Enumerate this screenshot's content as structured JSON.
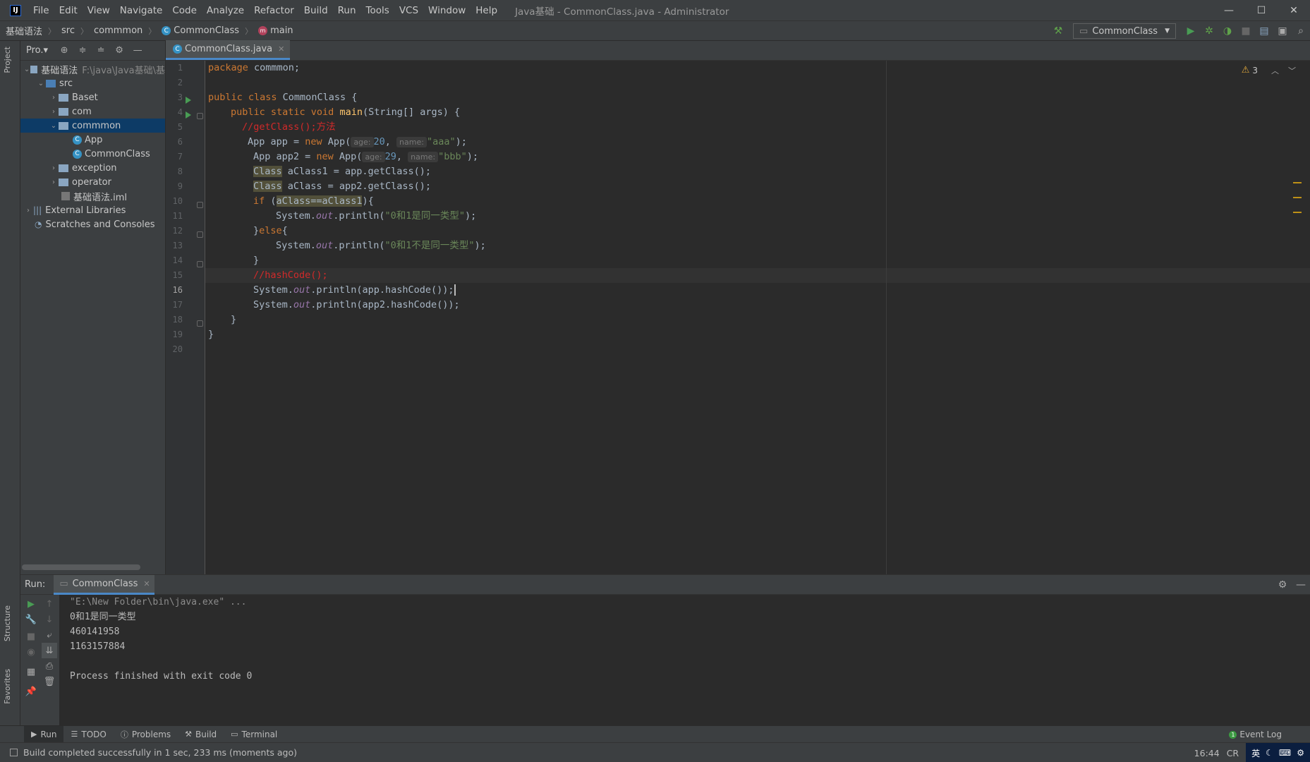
{
  "titlebar": {
    "logo": "IJ",
    "menu": [
      "File",
      "Edit",
      "View",
      "Navigate",
      "Code",
      "Analyze",
      "Refactor",
      "Build",
      "Run",
      "Tools",
      "VCS",
      "Window",
      "Help"
    ],
    "title": "Java基础 - CommonClass.java - Administrator",
    "minimize": "—",
    "maximize": "☐",
    "close": "✕"
  },
  "breadcrumb": {
    "items": [
      "基础语法",
      "src",
      "commmon",
      "CommonClass",
      "main"
    ],
    "class_icon": "C",
    "method_icon": "m"
  },
  "toolbar": {
    "run_config": "CommonClass"
  },
  "left_strip": {
    "project_label": "Project",
    "structure_label": "Structure",
    "favorites_label": "Favorites"
  },
  "project": {
    "header": "Pro.▾",
    "tree": {
      "root": {
        "label": "基础语法",
        "path": "F:\\java\\Java基础\\基"
      },
      "src": "src",
      "baset": "Baset",
      "com": "com",
      "common": "commmon",
      "app": "App",
      "commonclass": "CommonClass",
      "exception": "exception",
      "operator": "operator",
      "iml": "基础语法.iml",
      "external": "External Libraries",
      "scratches": "Scratches and Consoles"
    }
  },
  "editor": {
    "tab": "CommonClass.java",
    "warnings": "3",
    "line_numbers": [
      "1",
      "2",
      "3",
      "4",
      "5",
      "6",
      "7",
      "8",
      "9",
      "10",
      "11",
      "12",
      "13",
      "14",
      "15",
      "16",
      "17",
      "18",
      "19",
      "20"
    ],
    "code": {
      "l1_kw": "package",
      "l1_rest": " commmon;",
      "l3_kw1": "public class",
      "l3_rest": " CommonClass {",
      "l4_kw": "public static void",
      "l4_fn": "main",
      "l4_rest": "(String[] args) {",
      "l5_cmt": "//getClass();方法",
      "l6_a": "App app = ",
      "l6_kw": "new",
      "l6_b": " App(",
      "l6_h1": "age:",
      "l6_n": "20",
      "l6_c": ", ",
      "l6_h2": "name:",
      "l6_s": "\"aaa\"",
      "l6_d": ");",
      "l7_a": "App app2 = ",
      "l7_kw": "new",
      "l7_b": " App(",
      "l7_h1": "age:",
      "l7_n": "29",
      "l7_c": ", ",
      "l7_h2": "name:",
      "l7_s": "\"bbb\"",
      "l7_d": ");",
      "l8_cls": "Class",
      "l8_rest": " aClass1 = app.getClass();",
      "l9_cls": "Class",
      "l9_rest": " aClass = app2.getClass();",
      "l10_kw": "if",
      "l10_a": " (",
      "l10_hl": "aClass==aClass1",
      "l10_b": "){",
      "l11_a": "System.",
      "l11_st": "out",
      "l11_b": ".println(",
      "l11_s": "\"0和1是同一类型\"",
      "l11_c": ");",
      "l12_a": "}",
      "l12_kw": "else",
      "l12_b": "{",
      "l13_a": "System.",
      "l13_st": "out",
      "l13_b": ".println(",
      "l13_s": "\"0和1不是同一类型\"",
      "l13_c": ");",
      "l14": "}",
      "l15_cmt": "//hashCode();",
      "l16_a": "System.",
      "l16_st": "out",
      "l16_b": ".println(app.hashCode());",
      "l17_a": "System.",
      "l17_st": "out",
      "l17_b": ".println(app2.hashCode());",
      "l18": "}",
      "l19": "}"
    }
  },
  "run": {
    "label": "Run:",
    "tab": "CommonClass",
    "console": [
      "\"E:\\New Folder\\bin\\java.exe\" ...",
      "0和1是同一类型",
      "460141958",
      "1163157884",
      "",
      "Process finished with exit code 0"
    ]
  },
  "toolwindows": {
    "items": [
      "Run",
      "TODO",
      "Problems",
      "Build",
      "Terminal"
    ],
    "event_log": "Event Log"
  },
  "status": {
    "text": "Build completed successfully in 1 sec, 233 ms (moments ago)",
    "cursor": "16:44",
    "line_sep": "CR",
    "ime": "英"
  },
  "colors": {
    "keyword": "#cc7832",
    "string": "#6a8759",
    "number": "#6897bb",
    "comment": "#d12a2a",
    "function": "#ffc66d",
    "accent": "#4a88c7"
  }
}
